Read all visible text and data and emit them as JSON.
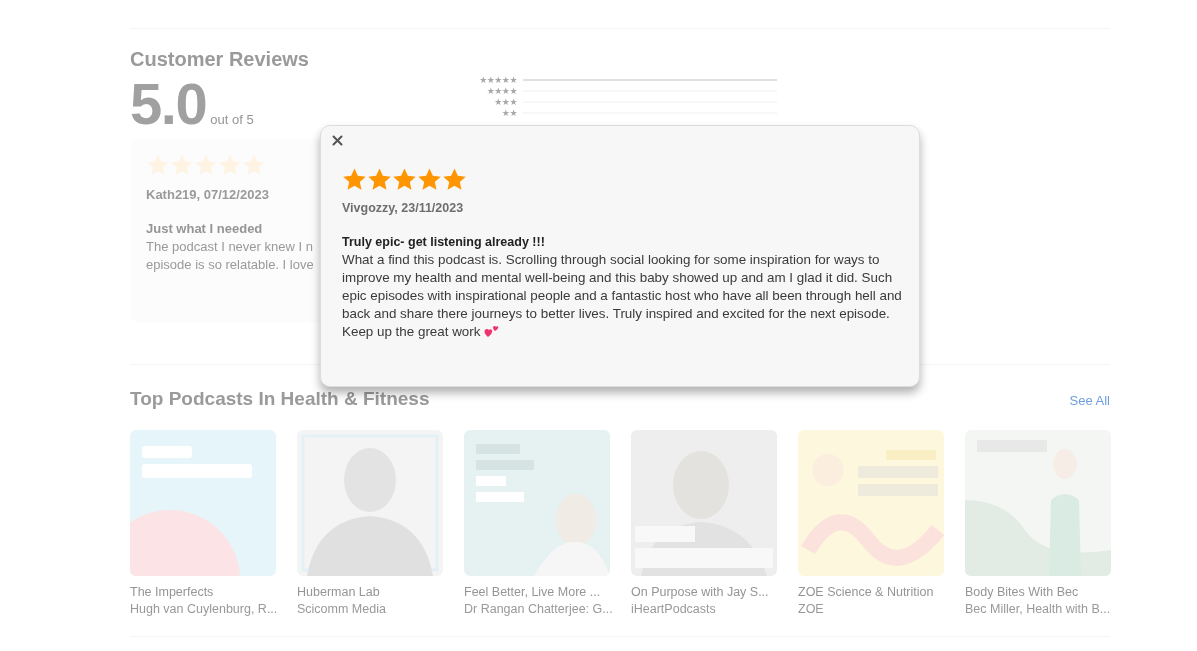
{
  "reviews_section": {
    "title": "Customer Reviews",
    "score": "5.0",
    "score_suffix": "out of 5",
    "histogram": [
      {
        "label": "★★★★★",
        "level": 1
      },
      {
        "label": "★★★★",
        "level": 0
      },
      {
        "label": "★★★",
        "level": 0
      },
      {
        "label": "★★",
        "level": 0
      }
    ]
  },
  "review_card": {
    "stars": 5,
    "author_date": "Kath219, 07/12/2023",
    "title": "Just what I needed",
    "body_lines": [
      "The podcast I never knew I n",
      "episode is so relatable. I love"
    ]
  },
  "top_podcasts": {
    "title": "Top Podcasts In Health & Fitness",
    "see_all": "See All",
    "items": [
      {
        "title": "The Imperfects",
        "subtitle": "Hugh van Cuylenburg, R...",
        "kind": "picture"
      },
      {
        "title": "Huberman Lab",
        "subtitle": "Scicomm Media",
        "kind": "picture"
      },
      {
        "title": "Feel Better, Live More ...",
        "subtitle": "Dr Rangan Chatterjee: G...",
        "kind": "picture"
      },
      {
        "title": "On Purpose with Jay S...",
        "subtitle": "iHeartPodcasts",
        "kind": "picture"
      },
      {
        "title": "ZOE Science & Nutrition",
        "subtitle": "ZOE",
        "kind": "picture"
      },
      {
        "title": "Body Bites With Bec",
        "subtitle": "Bec Miller, Health with B...",
        "kind": "picture"
      }
    ]
  },
  "dialog": {
    "stars": 5,
    "author_date": "Vivgozzy, 23/11/2023",
    "title": "Truly epic- get listening already !!!",
    "body": "What a find this podcast is. Scrolling through social looking for some inspiration for ways to improve my health and mental well-being and this baby showed up and am I glad it did. Such epic episodes with inspirational people and a fantastic host who have all been through hell and back and share there journeys to better lives. Truly inspired and excited for the next episode. Keep up the great work"
  }
}
